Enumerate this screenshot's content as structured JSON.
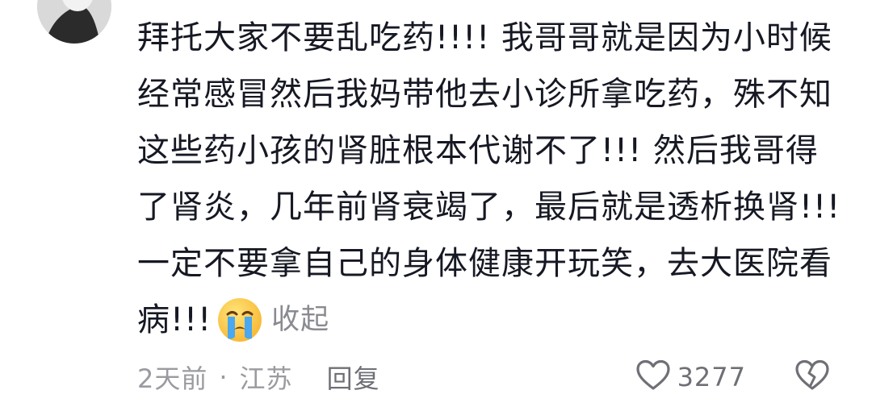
{
  "comment": {
    "lines": [
      "拜托大家不要乱吃药!!!! 我哥哥就是因为小时候",
      "经常感冒然后我妈带他去小诊所拿吃药，殊不知",
      "这些药小孩的肾脏根本代谢不了!!! 然后我哥得",
      "了肾炎，几年前肾衰竭了，最后就是透析换肾!!!",
      "一定不要拿自己的身体健康开玩笑，去大医院看"
    ],
    "last_line": "病!!!",
    "emoji_icon": "crying-face-emoji",
    "collapse_label": "收起"
  },
  "meta": {
    "time": "2天前",
    "separator": "·",
    "location": "江苏",
    "reply_label": "回复"
  },
  "actions": {
    "like_icon": "heart-outline-icon",
    "like_count": "3277",
    "dislike_icon": "broken-heart-icon"
  },
  "colors": {
    "text": "#161823",
    "muted": "#9a9ba0",
    "link": "#8a8b91"
  }
}
